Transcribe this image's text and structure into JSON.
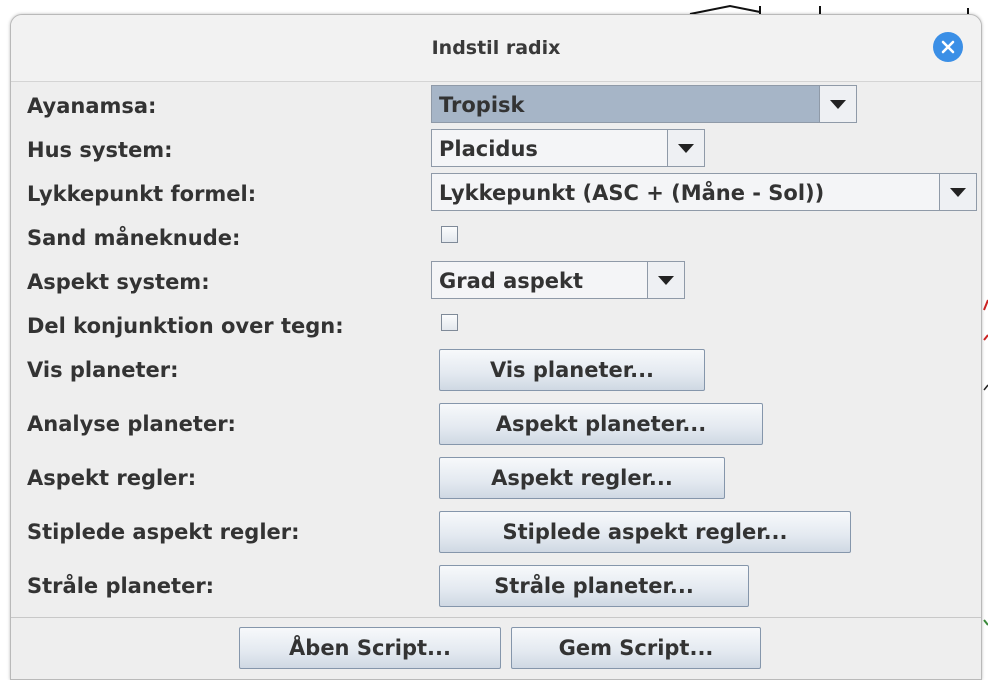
{
  "dialog": {
    "title": "Indstil radix"
  },
  "rows": [
    {
      "label": "Ayanamsa:",
      "type": "combo",
      "value": "Tropisk"
    },
    {
      "label": "Hus system:",
      "type": "combo",
      "value": "Placidus"
    },
    {
      "label": "Lykkepunkt formel:",
      "type": "combo",
      "value": "Lykkepunkt (ASC + (Måne - Sol))"
    },
    {
      "label": "Sand måneknude:",
      "type": "checkbox",
      "checked": false
    },
    {
      "label": "Aspekt system:",
      "type": "combo",
      "value": "Grad aspekt"
    },
    {
      "label": "Del konjunktion over tegn:",
      "type": "checkbox",
      "checked": false
    },
    {
      "label": "Vis planeter:",
      "type": "button",
      "button_label": "Vis planeter..."
    },
    {
      "label": "Analyse planeter:",
      "type": "button",
      "button_label": "Aspekt planeter..."
    },
    {
      "label": "Aspekt regler:",
      "type": "button",
      "button_label": "Aspekt regler..."
    },
    {
      "label": "Stiplede aspekt regler:",
      "type": "button",
      "button_label": "Stiplede aspekt regler..."
    },
    {
      "label": "Stråle planeter:",
      "type": "button",
      "button_label": "Stråle planeter..."
    }
  ],
  "footer": {
    "open_label": "Åben Script...",
    "save_label": "Gem Script..."
  },
  "colors": {
    "close_button": "#3b8fe6",
    "selected_combo": "#a6b5c7",
    "dialog_bg": "#eeeeee"
  }
}
